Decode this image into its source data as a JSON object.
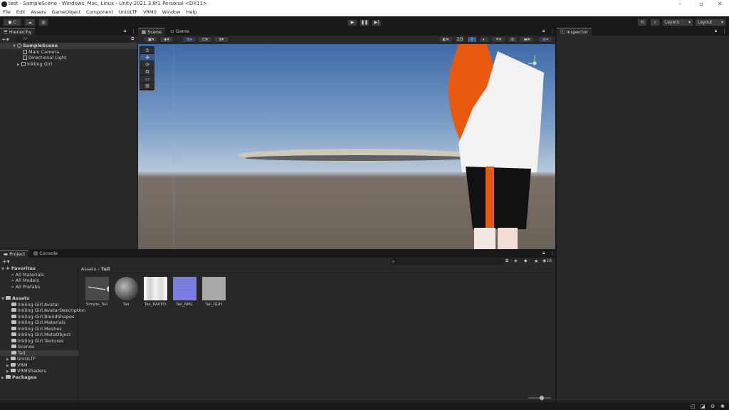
{
  "window": {
    "title": "test - SampleScene - Windows, Mac, Linux - Unity 2021.3.8f1 Personal <DX11>"
  },
  "menu": [
    "File",
    "Edit",
    "Assets",
    "GameObject",
    "Component",
    "UniGLTF",
    "VRM0",
    "Window",
    "Help"
  ],
  "toolbar": {
    "account_label": "C",
    "layers_label": "Layers",
    "layout_label": "Layout"
  },
  "hierarchy": {
    "tab": "Hierarchy",
    "search_placeholder": "All",
    "scene": "SampleScene",
    "items": [
      "Main Camera",
      "Directional Light",
      "Inkling Girl"
    ]
  },
  "scene_tabs": {
    "scene": "Scene",
    "game": "Game",
    "mode_2d": "2D"
  },
  "inspector": {
    "tab": "Inspector"
  },
  "project": {
    "tab_project": "Project",
    "tab_console": "Console",
    "favorites_label": "Favorites",
    "favorites": [
      "All Materials",
      "All Models",
      "All Prefabs"
    ],
    "assets_label": "Assets",
    "asset_folders": [
      "Inkling Girl.Avatar",
      "Inkling Girl.AvatarDescription",
      "Inkling Girl.BlendShapes",
      "Inkling Girl.Materials",
      "Inkling Girl.Meshes",
      "Inkling Girl.MetaObject",
      "Inkling Girl.Textures",
      "Scenes",
      "Tail",
      "UniGLTF",
      "VRM",
      "VRMShaders"
    ],
    "packages_label": "Packages",
    "breadcrumb": [
      "Assets",
      "Tail"
    ],
    "visible_count": "16",
    "assets": [
      {
        "name": "Simple_Tail",
        "color": "#4a4a4a"
      },
      {
        "name": "Tail",
        "color": "#555555"
      },
      {
        "name": "Tail_BAKED",
        "color": "#e6e6e6"
      },
      {
        "name": "Tail_NML",
        "color": "#6f73d8"
      },
      {
        "name": "Tail_RGH",
        "color": "#a8a8a8"
      }
    ]
  },
  "colors": {
    "accent": "#3a7ad9",
    "hair": "#e8580f",
    "shirt": "#f2f2f5",
    "skirt": "#111111"
  }
}
